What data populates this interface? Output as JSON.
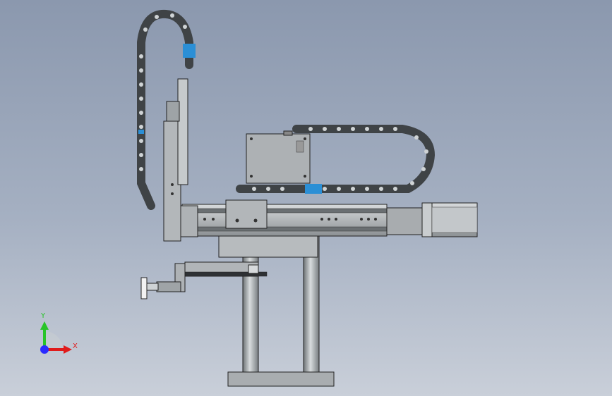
{
  "viewport": {
    "background_top": "#8b98ae",
    "background_bottom": "#c9cfd9"
  },
  "triad": {
    "x_label": "X",
    "y_label": "Y",
    "x_color": "#e01b1b",
    "y_color": "#28c428",
    "z_color": "#2a2aff"
  },
  "model": {
    "name": "linear-robot-arm-assembly",
    "link_color": "#3f4346",
    "accent_link_color": "#2b8fd6",
    "frame_color": "#9aa0a3"
  }
}
